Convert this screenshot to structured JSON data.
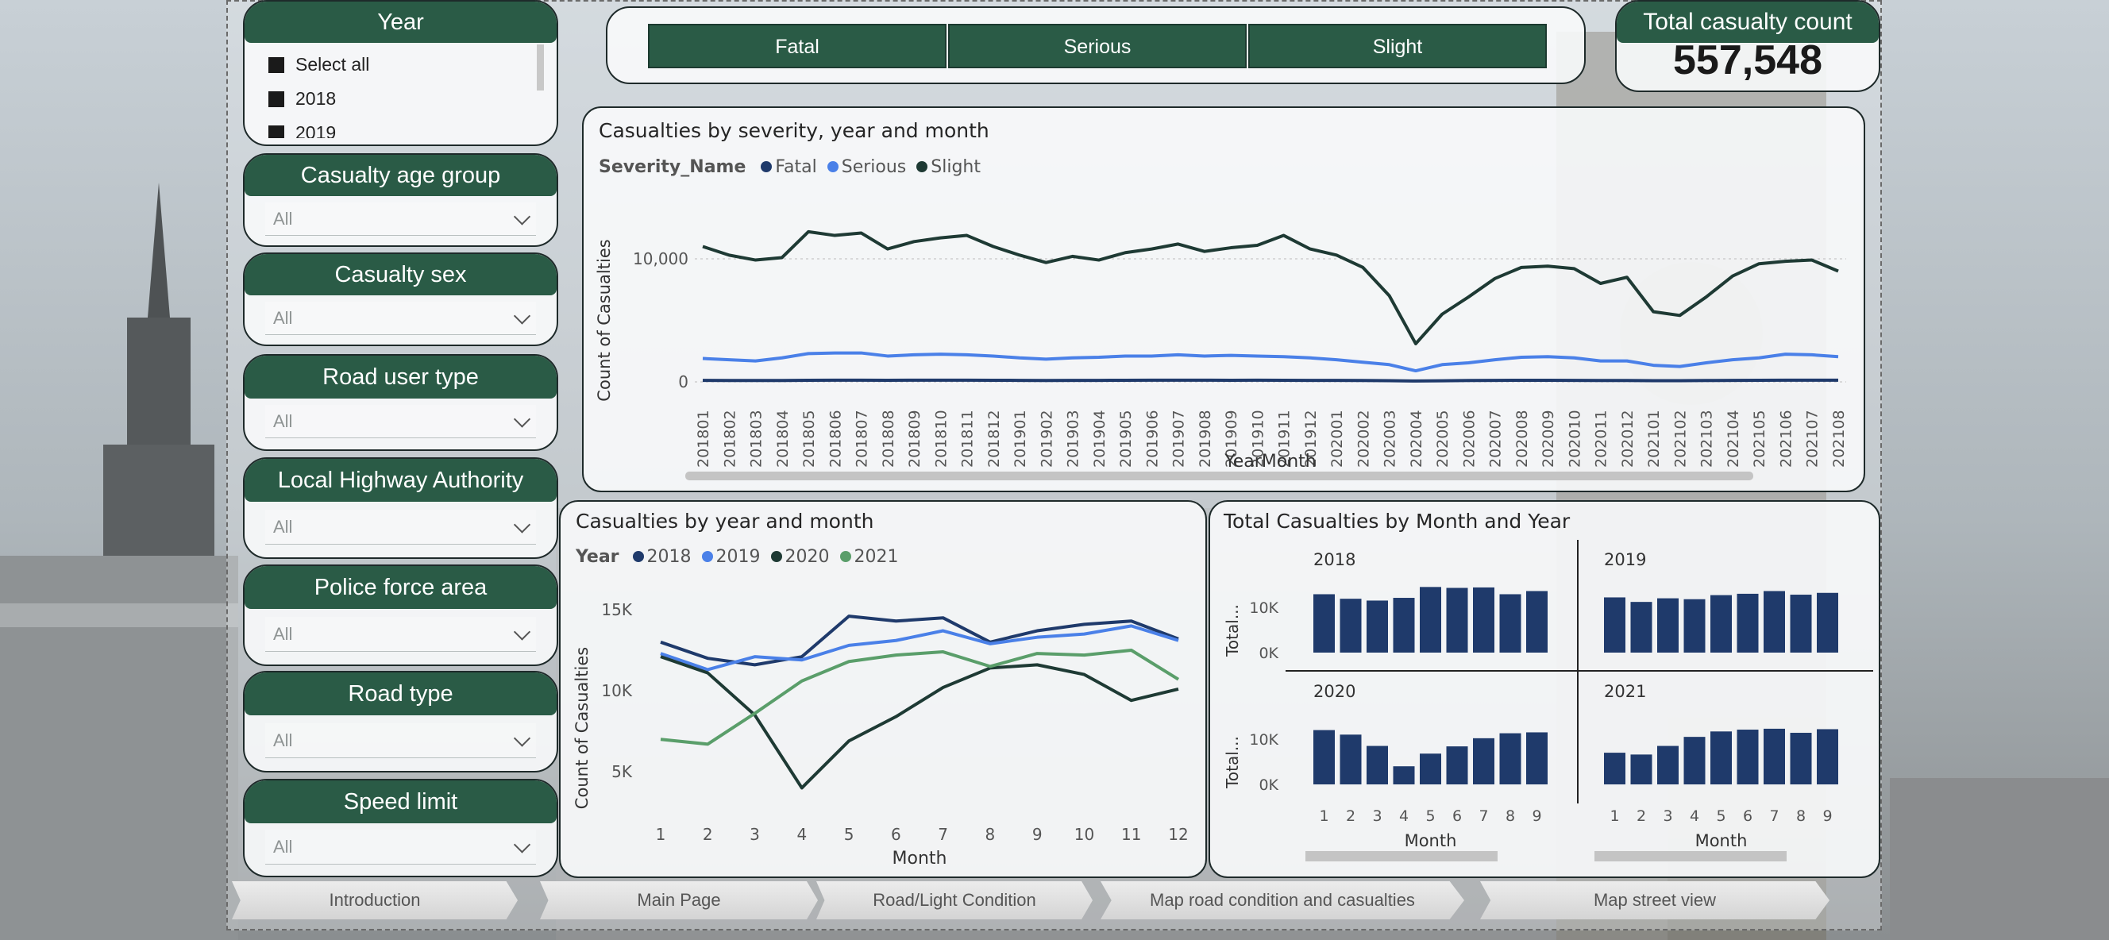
{
  "slicers": {
    "year": {
      "title": "Year",
      "items": [
        "Select all",
        "2018",
        "2019"
      ]
    },
    "age": {
      "title": "Casualty age group",
      "value": "All"
    },
    "sex": {
      "title": "Casualty sex",
      "value": "All"
    },
    "road_user": {
      "title": "Road user type",
      "value": "All"
    },
    "lha": {
      "title": "Local Highway Authority",
      "value": "All"
    },
    "police": {
      "title": "Police force area",
      "value": "All"
    },
    "road_type": {
      "title": "Road type",
      "value": "All"
    },
    "speed": {
      "title": "Speed limit",
      "value": "All"
    }
  },
  "severity_buttons": [
    "Fatal",
    "Serious",
    "Slight"
  ],
  "kpi": {
    "title": "Total casualty count",
    "value": "557,548"
  },
  "nav": [
    "Introduction",
    "Main Page",
    "Road/Light Condition",
    "Map road condition and casualties",
    "Map street view"
  ],
  "colors": {
    "dark_green": "#2a5b46",
    "navy": "#1f3a6b",
    "blue": "#4a80e8",
    "dark": "#1e3a34",
    "green": "#5a9e6a",
    "bar": "#1f3a6b"
  },
  "chart_data": [
    {
      "type": "line",
      "title": "Casualties by severity, year and month",
      "legend_title": "Severity_Name",
      "xlabel": "YearMonth",
      "ylabel": "Count of Casualties",
      "yticks": [
        0,
        10000
      ],
      "ytick_labels": [
        "0",
        "10,000"
      ],
      "ylim": [
        0,
        13500
      ],
      "categories": [
        "201801",
        "201802",
        "201803",
        "201804",
        "201805",
        "201806",
        "201807",
        "201808",
        "201809",
        "201810",
        "201811",
        "201812",
        "201901",
        "201902",
        "201903",
        "201904",
        "201905",
        "201906",
        "201907",
        "201908",
        "201909",
        "201910",
        "201911",
        "201912",
        "202001",
        "202002",
        "202003",
        "202004",
        "202005",
        "202006",
        "202007",
        "202008",
        "202009",
        "202010",
        "202011",
        "202012",
        "202101",
        "202102",
        "202103",
        "202104",
        "202105",
        "202106",
        "202107",
        "202108"
      ],
      "series": [
        {
          "name": "Fatal",
          "color": "#1f3a6b",
          "values": [
            120,
            110,
            115,
            115,
            130,
            135,
            140,
            130,
            135,
            140,
            135,
            130,
            125,
            115,
            120,
            125,
            130,
            135,
            140,
            135,
            130,
            135,
            130,
            125,
            120,
            110,
            100,
            70,
            90,
            110,
            120,
            130,
            130,
            125,
            115,
            110,
            100,
            95,
            110,
            120,
            130,
            135,
            140,
            135
          ]
        },
        {
          "name": "Serious",
          "color": "#4a80e8",
          "values": [
            1900,
            1800,
            1700,
            1950,
            2300,
            2350,
            2350,
            2100,
            2200,
            2250,
            2200,
            2100,
            1950,
            1850,
            1950,
            2000,
            2100,
            2100,
            2200,
            2100,
            2150,
            2100,
            2050,
            1950,
            1800,
            1600,
            1400,
            900,
            1400,
            1550,
            1800,
            2000,
            2050,
            1950,
            1700,
            1700,
            1350,
            1250,
            1550,
            1800,
            1950,
            2250,
            2200,
            2050
          ]
        },
        {
          "name": "Slight",
          "color": "#1e3a34",
          "values": [
            11000,
            10300,
            9900,
            10100,
            12200,
            11900,
            12100,
            10800,
            11400,
            11700,
            11900,
            11000,
            10300,
            9700,
            10200,
            9900,
            10500,
            10800,
            11200,
            10600,
            10900,
            11100,
            11900,
            10800,
            10300,
            9300,
            7000,
            3100,
            5500,
            6900,
            8400,
            9300,
            9400,
            9200,
            8000,
            8500,
            5700,
            5400,
            6900,
            8600,
            9600,
            9800,
            9900,
            9000
          ]
        }
      ]
    },
    {
      "type": "line",
      "title": "Casualties by year and month",
      "legend_title": "Year",
      "xlabel": "Month",
      "ylabel": "Count of Casualties",
      "yticks": [
        5000,
        10000,
        15000
      ],
      "ytick_labels": [
        "5K",
        "10K",
        "15K"
      ],
      "ylim": [
        2500,
        15500
      ],
      "x": [
        1,
        2,
        3,
        4,
        5,
        6,
        7,
        8,
        9,
        10,
        11,
        12
      ],
      "series": [
        {
          "name": "2018",
          "color": "#1f3a6b",
          "values": [
            13000,
            12000,
            11600,
            12100,
            14600,
            14300,
            14500,
            13000,
            13700,
            14100,
            14300,
            13200
          ]
        },
        {
          "name": "2019",
          "color": "#4a80e8",
          "values": [
            12300,
            11300,
            12100,
            11900,
            12800,
            13100,
            13700,
            12900,
            13300,
            13500,
            14000,
            13100
          ]
        },
        {
          "name": "2020",
          "color": "#1e3a34",
          "values": [
            12100,
            11100,
            8500,
            4000,
            6900,
            8400,
            10200,
            11400,
            11600,
            11000,
            9400,
            10100
          ]
        },
        {
          "name": "2021",
          "color": "#5a9e6a",
          "values": [
            7000,
            6700,
            8600,
            10600,
            11800,
            12200,
            12400,
            11500,
            12300,
            12200,
            12500,
            10700
          ]
        }
      ]
    },
    {
      "type": "bar",
      "title": "Total Casualties by Month and Year",
      "ylabel": "Total...",
      "xlabel": "Month",
      "yticks": [
        0,
        10000
      ],
      "ytick_labels": [
        "0K",
        "10K"
      ],
      "ylim": [
        0,
        15500
      ],
      "categories": [
        1,
        2,
        3,
        4,
        5,
        6,
        7,
        8,
        9
      ],
      "series": [
        {
          "name": "2018",
          "values": [
            12900,
            11900,
            11500,
            12100,
            14500,
            14300,
            14400,
            12900,
            13600
          ]
        },
        {
          "name": "2019",
          "values": [
            12200,
            11200,
            12000,
            11800,
            12700,
            13000,
            13600,
            12800,
            13200
          ]
        },
        {
          "name": "2020",
          "values": [
            12000,
            11000,
            8500,
            4000,
            6800,
            8400,
            10200,
            11300,
            11500
          ]
        },
        {
          "name": "2021",
          "values": [
            7000,
            6600,
            8500,
            10500,
            11700,
            12100,
            12300,
            11400,
            12200
          ]
        }
      ]
    }
  ]
}
